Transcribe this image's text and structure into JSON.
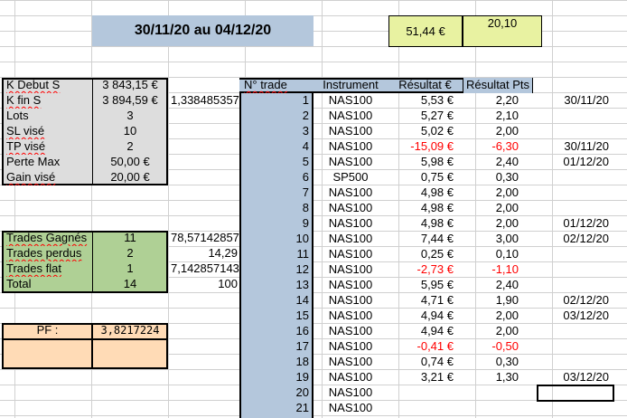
{
  "title": "30/11/20 au 04/12/20",
  "totals": {
    "result_eur": "51,44 €",
    "result_pts": "20,10"
  },
  "params": [
    {
      "label": "K Debut S",
      "value": "3 843,15 €",
      "extra": ""
    },
    {
      "label": "K fin S",
      "value": "3 894,59 €",
      "extra": "1,338485357"
    },
    {
      "label": "Lots",
      "value": "3",
      "extra": ""
    },
    {
      "label": "SL visé",
      "value": "10",
      "extra": ""
    },
    {
      "label": "TP visé",
      "value": "2",
      "extra": ""
    },
    {
      "label": "Perte Max",
      "value": "50,00 €",
      "extra": ""
    },
    {
      "label": "Gain visé",
      "value": "20,00 €",
      "extra": ""
    }
  ],
  "summary": [
    {
      "label": "Trades Gagnés",
      "value": "11",
      "pct": "78,57142857"
    },
    {
      "label": "Trades perdus",
      "value": "2",
      "pct": "14,29"
    },
    {
      "label": "Trades flat",
      "value": "1",
      "pct": "7,142857143"
    },
    {
      "label": "Total",
      "value": "14",
      "pct": "100"
    }
  ],
  "pf": {
    "label": "PF :",
    "value": "3,8217224"
  },
  "trades_header": {
    "num": "N° trade",
    "instrument": "Instrument",
    "result_eur": "Résultat €",
    "result_pts": "Résultat Pts"
  },
  "trades": [
    {
      "num": "1",
      "instrument": "NAS100",
      "eur": "5,53 €",
      "pts": "2,20",
      "date": "30/11/20",
      "neg": false
    },
    {
      "num": "2",
      "instrument": "NAS100",
      "eur": "5,27 €",
      "pts": "2,10",
      "date": "",
      "neg": false
    },
    {
      "num": "3",
      "instrument": "NAS100",
      "eur": "5,02 €",
      "pts": "2,00",
      "date": "",
      "neg": false
    },
    {
      "num": "4",
      "instrument": "NAS100",
      "eur": "-15,09 €",
      "pts": "-6,30",
      "date": "30/11/20",
      "neg": true
    },
    {
      "num": "5",
      "instrument": "NAS100",
      "eur": "5,98 €",
      "pts": "2,40",
      "date": "01/12/20",
      "neg": false
    },
    {
      "num": "6",
      "instrument": "SP500",
      "eur": "0,75 €",
      "pts": "0,30",
      "date": "",
      "neg": false
    },
    {
      "num": "7",
      "instrument": "NAS100",
      "eur": "4,98 €",
      "pts": "2,00",
      "date": "",
      "neg": false
    },
    {
      "num": "8",
      "instrument": "NAS100",
      "eur": "4,98 €",
      "pts": "2,00",
      "date": "",
      "neg": false
    },
    {
      "num": "9",
      "instrument": "NAS100",
      "eur": "4,98 €",
      "pts": "2,00",
      "date": "01/12/20",
      "neg": false
    },
    {
      "num": "10",
      "instrument": "NAS100",
      "eur": "7,44 €",
      "pts": "3,00",
      "date": "02/12/20",
      "neg": false
    },
    {
      "num": "11",
      "instrument": "NAS100",
      "eur": "0,25 €",
      "pts": "0,10",
      "date": "",
      "neg": false
    },
    {
      "num": "12",
      "instrument": "NAS100",
      "eur": "-2,73 €",
      "pts": "-1,10",
      "date": "",
      "neg": true
    },
    {
      "num": "13",
      "instrument": "NAS100",
      "eur": "5,95 €",
      "pts": "2,40",
      "date": "",
      "neg": false
    },
    {
      "num": "14",
      "instrument": "NAS100",
      "eur": "4,71 €",
      "pts": "1,90",
      "date": "02/12/20",
      "neg": false
    },
    {
      "num": "15",
      "instrument": "NAS100",
      "eur": "4,94 €",
      "pts": "2,00",
      "date": "03/12/20",
      "neg": false
    },
    {
      "num": "16",
      "instrument": "NAS100",
      "eur": "4,94 €",
      "pts": "2,00",
      "date": "",
      "neg": false
    },
    {
      "num": "17",
      "instrument": "NAS100",
      "eur": "-0,41 €",
      "pts": "-0,50",
      "date": "",
      "neg": true
    },
    {
      "num": "18",
      "instrument": "NAS100",
      "eur": "0,74 €",
      "pts": "0,30",
      "date": "",
      "neg": false
    },
    {
      "num": "19",
      "instrument": "NAS100",
      "eur": "3,21 €",
      "pts": "1,30",
      "date": "03/12/20",
      "neg": false
    },
    {
      "num": "20",
      "instrument": "NAS100",
      "eur": "",
      "pts": "",
      "date": "",
      "neg": false
    },
    {
      "num": "21",
      "instrument": "NAS100",
      "eur": "",
      "pts": "",
      "date": "",
      "neg": false
    }
  ],
  "colors": {
    "title_bg": "#b4c7dc",
    "header_bg": "#b4c7dc",
    "num_col_bg": "#b4c7dc",
    "params_bg": "#dddddd",
    "summary_bg": "#afd095",
    "pf_bg": "#ffdbb6",
    "totals_bg": "#e8f2a1",
    "negative": "#ff0000",
    "grid": "#d0d0d0"
  }
}
